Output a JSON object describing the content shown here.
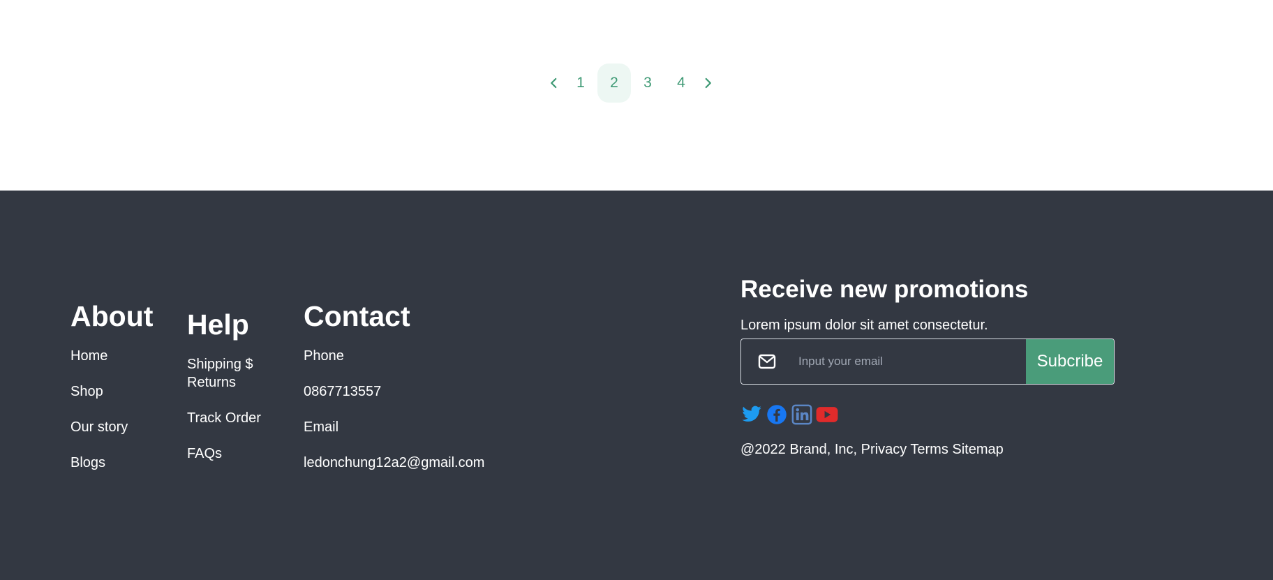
{
  "pagination": {
    "pages": [
      "1",
      "2",
      "3",
      "4"
    ],
    "active_page": "2"
  },
  "footer": {
    "about": {
      "title": "About",
      "links": [
        "Home",
        "Shop",
        "Our story",
        "Blogs"
      ]
    },
    "help": {
      "title": "Help",
      "links": [
        "Shipping $ Returns",
        "Track Order",
        "FAQs"
      ]
    },
    "contact": {
      "title": "Contact",
      "items": [
        "Phone",
        "0867713557",
        "Email",
        "ledonchung12a2@gmail.com"
      ]
    },
    "promotions": {
      "title": "Receive new promotions",
      "description": "Lorem ipsum dolor sit amet consectetur.",
      "email_placeholder": "Input your email",
      "subscribe_label": "Subcribe",
      "social": [
        "twitter-icon",
        "facebook-icon",
        "linkedin-icon",
        "youtube-icon"
      ],
      "copyright": "@2022 Brand, Inc, Privacy Terms Sitemap"
    }
  },
  "colors": {
    "accent": "#4a9c7a",
    "footer_bg": "#333842",
    "active_page_bg": "#edf7f3"
  }
}
